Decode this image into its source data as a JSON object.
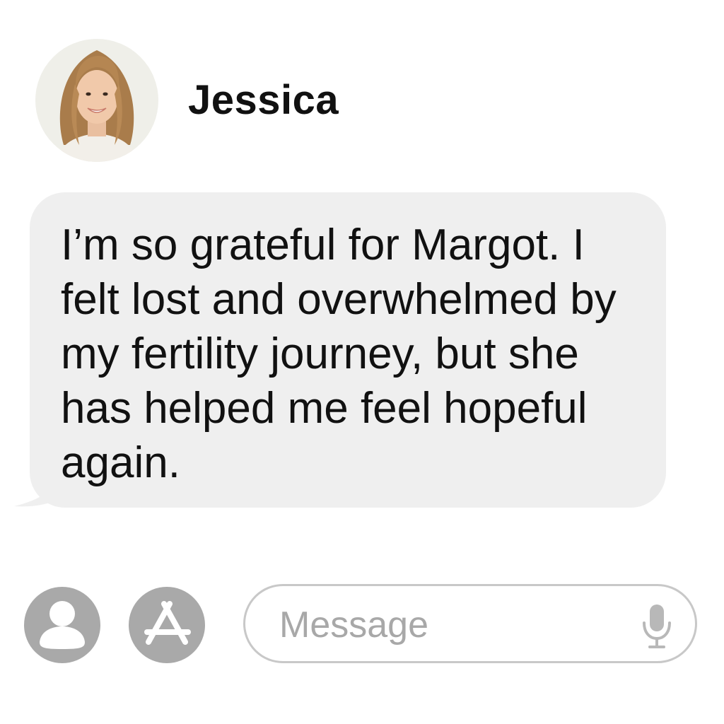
{
  "contact": {
    "name": "Jessica",
    "avatar_icon": "contact-photo"
  },
  "message": {
    "direction": "incoming",
    "text": "I’m so grateful for Margot. I felt lost and overwhelmed by my fertility journey, but she has helped me feel hopeful again."
  },
  "input_bar": {
    "contacts_icon": "person-icon",
    "apps_icon": "app-store-icon",
    "placeholder": "Message",
    "value": "",
    "mic_icon": "microphone-icon"
  },
  "colors": {
    "bubble": "#efefef",
    "icon_gray": "#a9a9a9",
    "field_border": "#c8c8c8",
    "placeholder": "#a8a8a8",
    "text": "#111111"
  }
}
